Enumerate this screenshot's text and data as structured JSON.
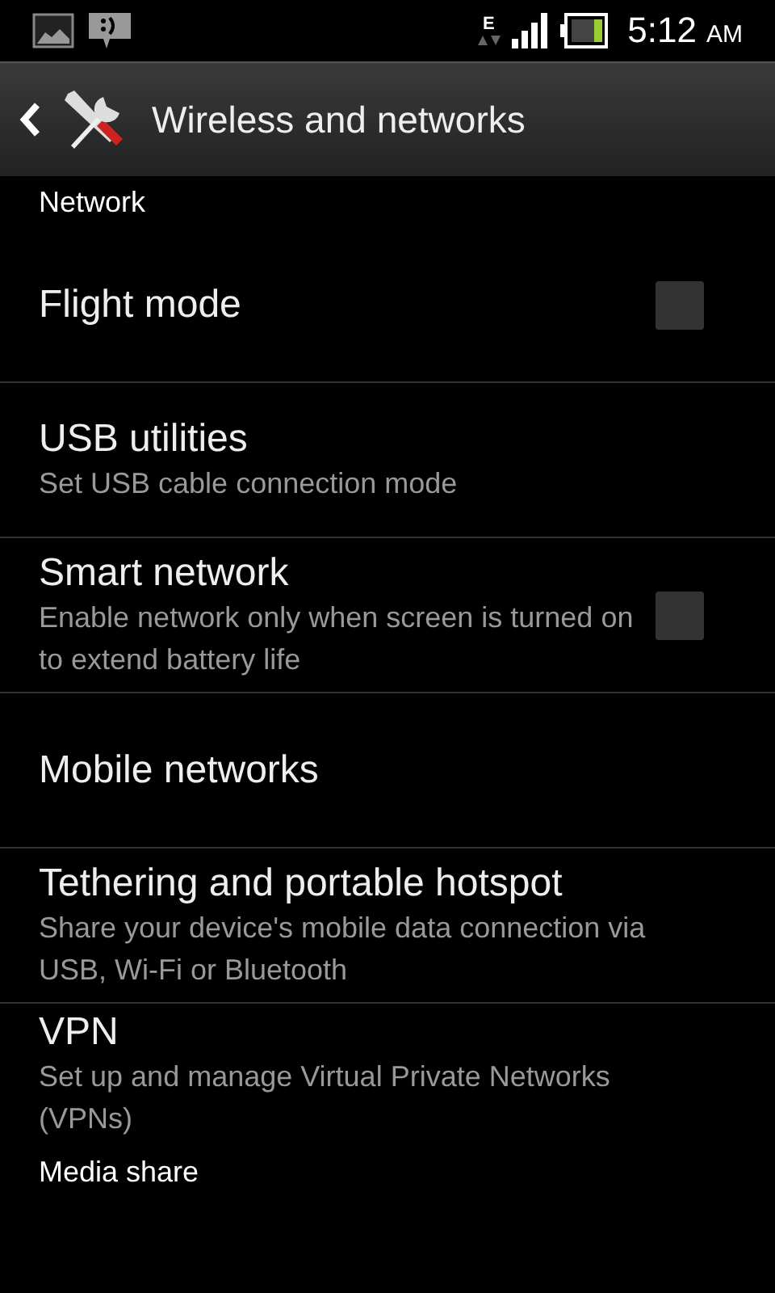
{
  "status_bar": {
    "network_type": "E",
    "time": "5:12",
    "ampm": "AM"
  },
  "action_bar": {
    "title": "Wireless and networks"
  },
  "sections": [
    {
      "header": "Network",
      "items": [
        {
          "kind": "checkbox",
          "title": "Flight mode",
          "checked": false
        },
        {
          "kind": "plain",
          "title": "USB utilities",
          "summary": "Set USB cable connection mode"
        },
        {
          "kind": "checkbox",
          "title": "Smart network",
          "summary": "Enable network only when screen is turned on to extend battery life",
          "checked": false
        },
        {
          "kind": "plain",
          "title": "Mobile networks"
        },
        {
          "kind": "plain",
          "title": "Tethering and portable hotspot",
          "summary": "Share your device's mobile data connection via USB, Wi-Fi or Bluetooth"
        },
        {
          "kind": "plain",
          "title": "VPN",
          "summary": "Set up and manage Virtual Private Networks (VPNs)"
        }
      ]
    },
    {
      "header": "Media share"
    }
  ]
}
